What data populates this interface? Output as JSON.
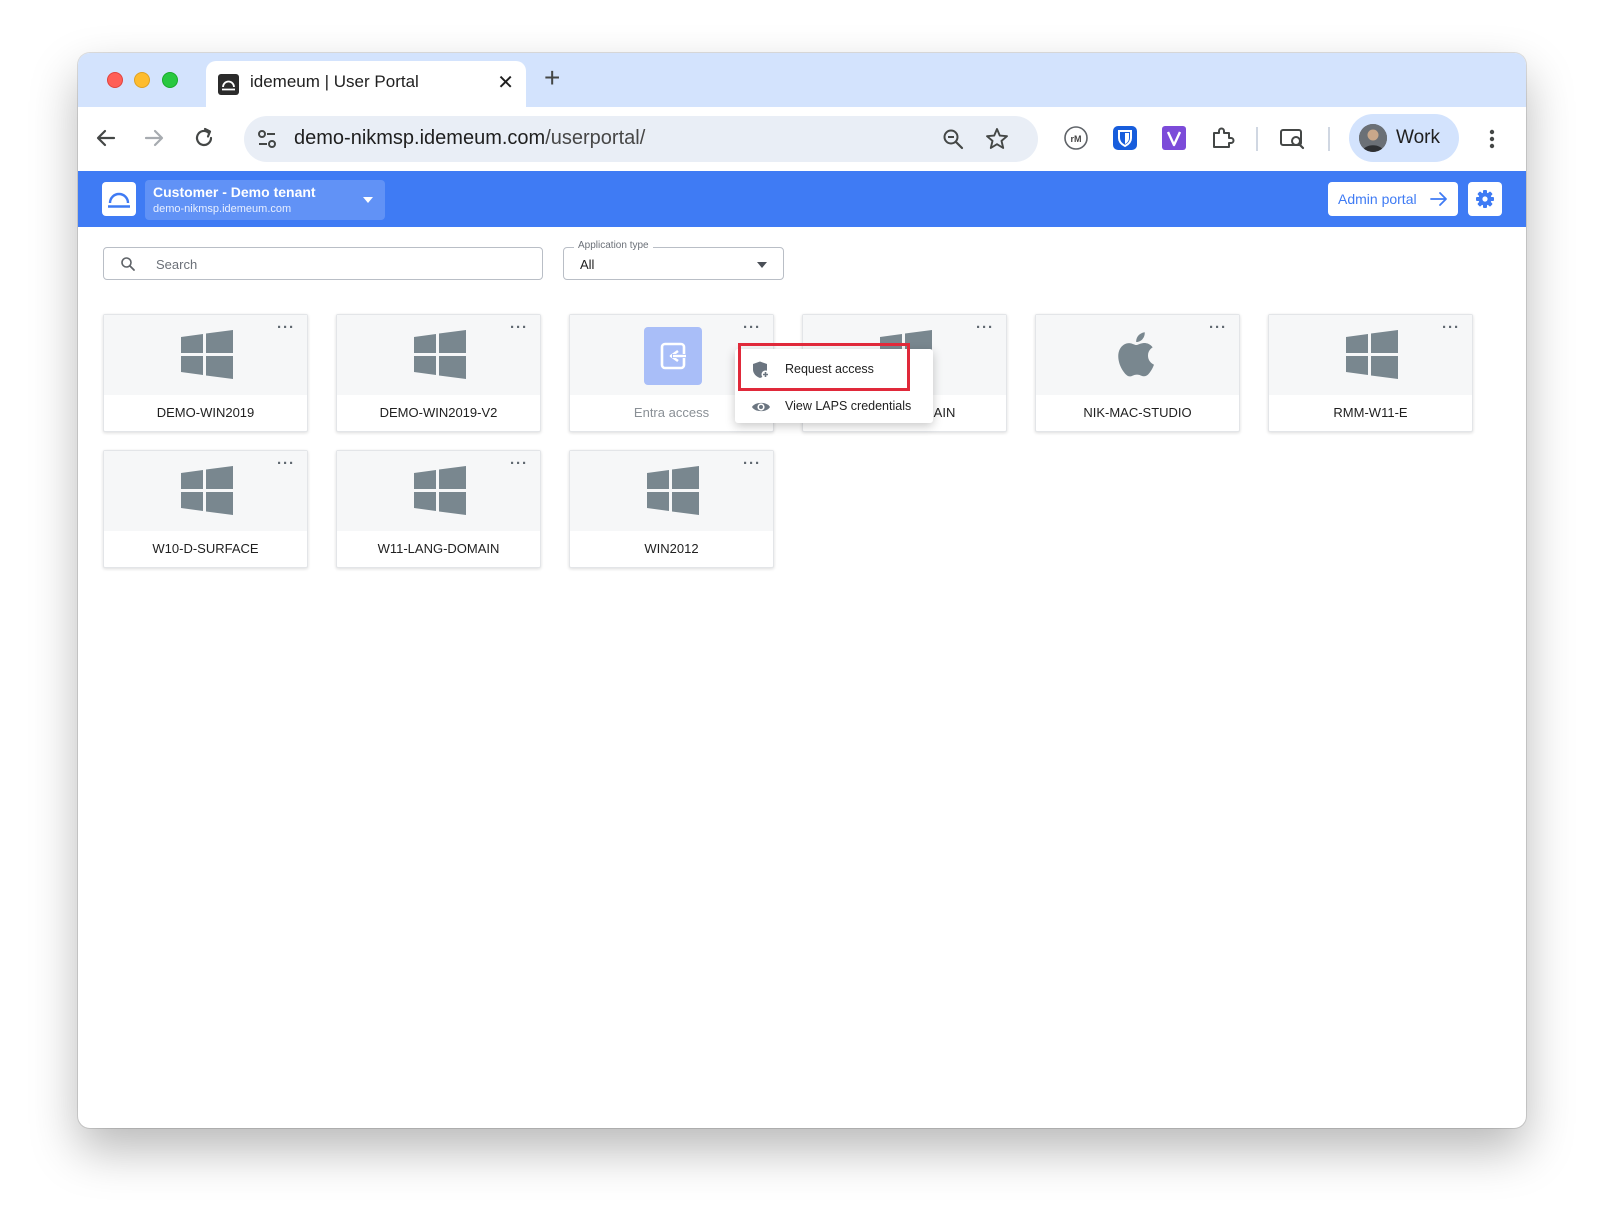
{
  "browser": {
    "tab_title": "idemeum | User Portal",
    "url_host": "demo-nikmsp.idemeum.com",
    "url_path": "/userportal/",
    "profile_label": "Work"
  },
  "header": {
    "tenant_name": "Customer - Demo tenant",
    "tenant_domain": "demo-nikmsp.idemeum.com",
    "admin_portal_label": "Admin portal",
    "brand_color": "#3f7bf4"
  },
  "filters": {
    "search_placeholder": "Search",
    "app_type_label": "Application type",
    "app_type_value": "All"
  },
  "apps": [
    {
      "label": "DEMO-WIN2019",
      "icon": "windows-icon"
    },
    {
      "label": "DEMO-WIN2019-V2",
      "icon": "windows-icon"
    },
    {
      "label": "Entra access",
      "icon": "entra-icon"
    },
    {
      "label": "AIN",
      "icon": "windows-icon"
    },
    {
      "label": "NIK-MAC-STUDIO",
      "icon": "apple-icon"
    },
    {
      "label": "RMM-W11-E",
      "icon": "windows-icon"
    },
    {
      "label": "W10-D-SURFACE",
      "icon": "windows-icon"
    },
    {
      "label": "W11-LANG-DOMAIN",
      "icon": "windows-icon"
    },
    {
      "label": "WIN2012",
      "icon": "windows-icon"
    }
  ],
  "context_menu": {
    "items": [
      {
        "label": "Request access",
        "icon": "shield-plus-icon"
      },
      {
        "label": "View LAPS credentials",
        "icon": "eye-icon"
      }
    ],
    "highlight_color": "#e0293a"
  }
}
